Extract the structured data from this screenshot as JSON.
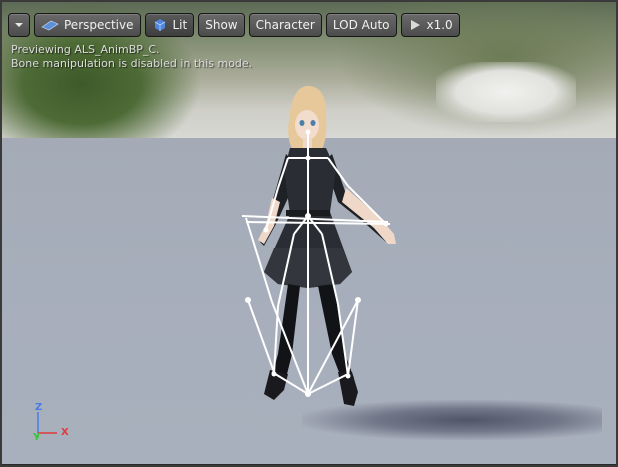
{
  "toolbar": {
    "menu_icon": "chevron-down-icon",
    "perspective_label": "Perspective",
    "lit_label": "Lit",
    "show_label": "Show",
    "character_label": "Character",
    "lod_label": "LOD Auto",
    "speed_label": "x1.0"
  },
  "info": {
    "line1": "Previewing ALS_AnimBP_C.",
    "line2": "Bone manipulation is disabled in this mode."
  },
  "axis": {
    "z": "Z",
    "y": "Y",
    "x": "X",
    "colors": {
      "x": "#e03a3a",
      "y": "#3ac43a",
      "z": "#4a7ae8"
    }
  }
}
